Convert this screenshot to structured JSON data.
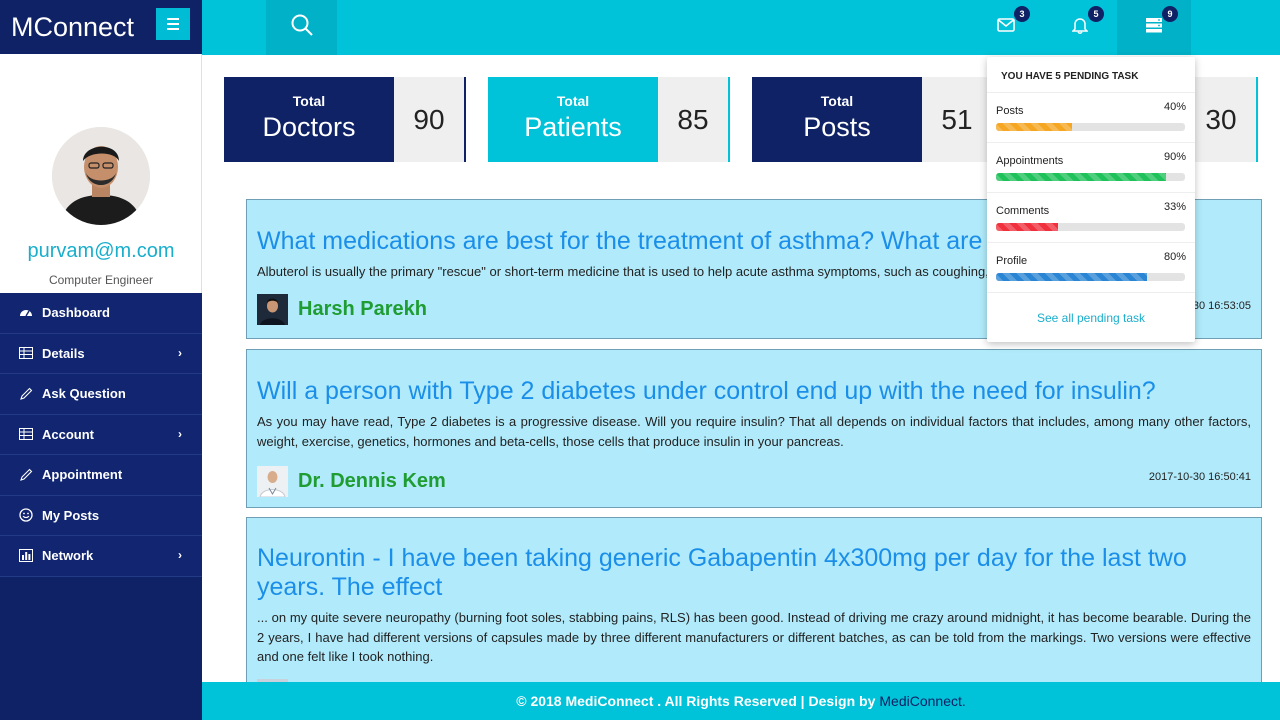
{
  "app": {
    "brand": "MConnect"
  },
  "profile": {
    "email": "purvam@m.com",
    "role": "Computer Engineer"
  },
  "nav": [
    {
      "label": "Dashboard",
      "icon": "dashboard-icon",
      "chevron": false
    },
    {
      "label": "Details",
      "icon": "table-icon",
      "chevron": true
    },
    {
      "label": "Ask Question",
      "icon": "pencil-icon",
      "chevron": false
    },
    {
      "label": "Account",
      "icon": "table-icon",
      "chevron": true
    },
    {
      "label": "Appointment",
      "icon": "pencil-icon",
      "chevron": false
    },
    {
      "label": "My Posts",
      "icon": "smiley-icon",
      "chevron": false
    },
    {
      "label": "Network",
      "icon": "chart-icon",
      "chevron": true
    }
  ],
  "topbar": {
    "messages_count": "3",
    "notifications_count": "5",
    "tasks_count": "9"
  },
  "stats": [
    {
      "small": "Total",
      "big": "Doctors",
      "value": "90",
      "color": "#0f2265"
    },
    {
      "small": "Total",
      "big": "Patients",
      "value": "85",
      "color": "#00c2d8"
    },
    {
      "small": "Total",
      "big": "Posts",
      "value": "51",
      "color": "#0f2265"
    },
    {
      "value": "30",
      "color": "#00c2d8"
    }
  ],
  "posts": [
    {
      "title": "What medications are best for the treatment of asthma? What are the side effects?",
      "body": "Albuterol is usually the primary \"rescue\" or short-term medicine that is used to help acute asthma symptoms, such as coughing, wheezing and shortness of breath.",
      "author": "Harsh Parekh",
      "date": "2017-10-30 16:53:05"
    },
    {
      "title": "Will a person with Type 2 diabetes under control end up with the need for insulin?",
      "body": "As you may have read, Type 2 diabetes is a progressive disease. Will you require insulin? That all depends on individual factors that includes, among many other factors, weight, exercise, genetics, hormones and beta-cells, those cells that produce insulin in your pancreas.",
      "author": "Dr. Dennis Kem",
      "date": "2017-10-30 16:50:41"
    },
    {
      "title": "Neurontin - I have been taking generic Gabapentin 4x300mg per day for the last two years. The effect",
      "body": "... on my quite severe neuropathy (burning foot soles, stabbing pains, RLS) has been good. Instead of driving me crazy around midnight, it has become bearable. During the 2 years, I have had different versions of capsules made by three different manufacturers or different batches, as can be told from the markings. Two versions were effective and one felt like I took nothing.",
      "author": "",
      "date": ""
    }
  ],
  "tasks": {
    "header": "YOU HAVE 5 PENDING TASK",
    "items": [
      {
        "name": "Posts",
        "pct_label": "40%",
        "fraction": 0.4,
        "color": "#f5a623"
      },
      {
        "name": "Appointments",
        "pct_label": "90%",
        "fraction": 0.9,
        "color": "#1ec15a"
      },
      {
        "name": "Comments",
        "pct_label": "33%",
        "fraction": 0.33,
        "color": "#f0303c"
      },
      {
        "name": "Profile",
        "pct_label": "80%",
        "fraction": 0.8,
        "color": "#2a86d4"
      }
    ],
    "see_all": "See all pending task"
  },
  "footer": {
    "text": "© 2018 MediConnect . All Rights Reserved | Design by",
    "brand": "MediConnect."
  }
}
